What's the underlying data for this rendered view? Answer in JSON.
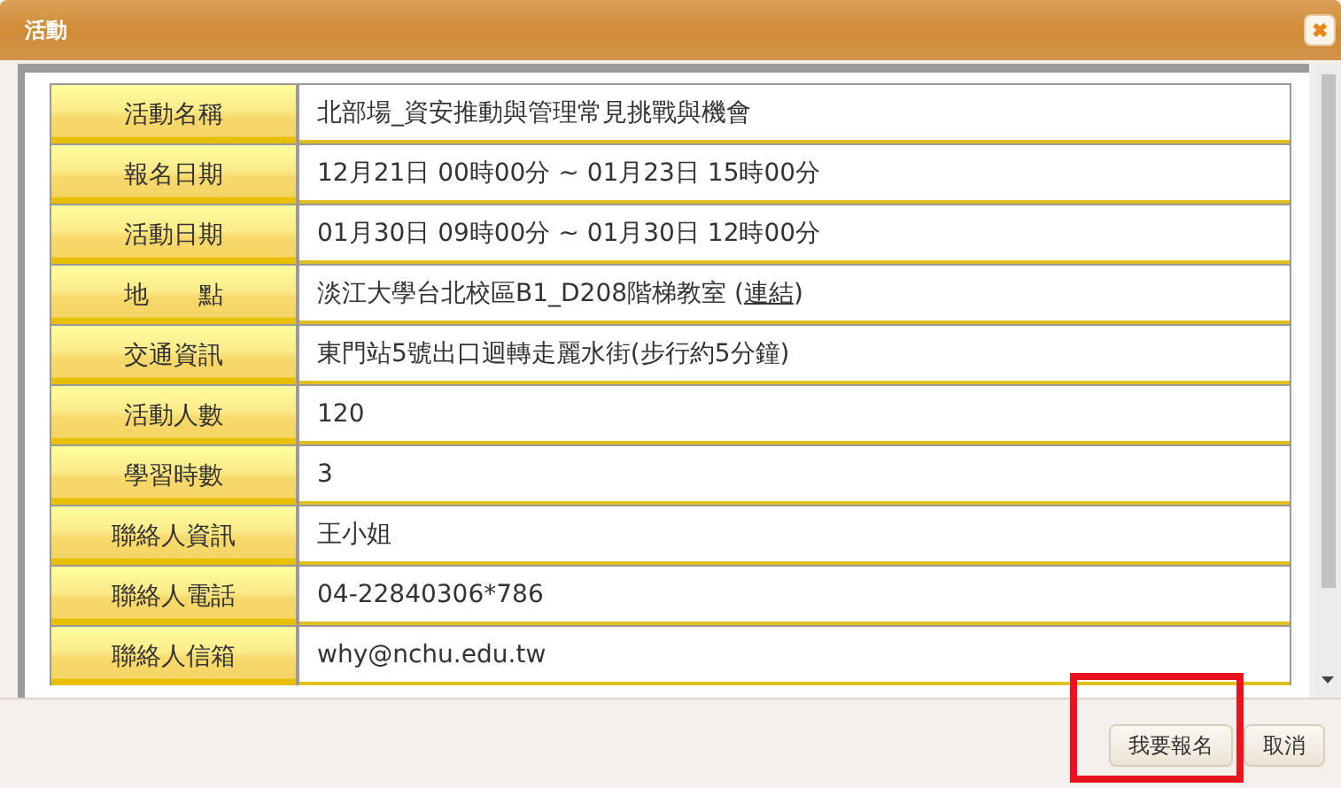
{
  "window": {
    "title": "活動",
    "close": "✖"
  },
  "rows": [
    {
      "label": "活動名稱",
      "value": "北部場_資安推動與管理常見挑戰與機會"
    },
    {
      "label": "報名日期",
      "value": "12月21日 00時00分 ~ 01月23日 15時00分"
    },
    {
      "label": "活動日期",
      "value": "01月30日 09時00分 ~ 01月30日 12時00分"
    },
    {
      "label": "地　　點",
      "value": "淡江大學台北校區B1_D208階梯教室 (",
      "link": "連結",
      "suffix": ")"
    },
    {
      "label": "交通資訊",
      "value": "東門站5號出口迴轉走麗水街(步行約5分鐘)"
    },
    {
      "label": "活動人數",
      "value": "120"
    },
    {
      "label": "學習時數",
      "value": "3"
    },
    {
      "label": "聯絡人資訊",
      "value": "王小姐"
    },
    {
      "label": "聯絡人電話",
      "value": "04-22840306*786"
    },
    {
      "label": "聯絡人信箱",
      "value": "why@nchu.edu.tw"
    }
  ],
  "buttons": [
    {
      "label": "我要報名",
      "highlighted": true
    },
    {
      "label": "取消",
      "highlighted": false
    }
  ]
}
